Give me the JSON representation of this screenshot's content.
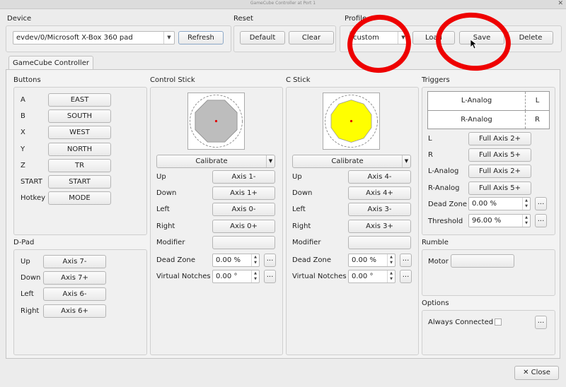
{
  "window": {
    "title": "GameCube Controller at Port 1",
    "close_glyph": "✕"
  },
  "device": {
    "label": "Device",
    "selected": "evdev/0/Microsoft X-Box 360 pad",
    "refresh": "Refresh"
  },
  "reset": {
    "label": "Reset",
    "default": "Default",
    "clear": "Clear"
  },
  "profile": {
    "label": "Profile",
    "value": "custom",
    "load": "Load",
    "save": "Save",
    "delete": "Delete"
  },
  "tab": {
    "label": "GameCube Controller"
  },
  "buttons": {
    "title": "Buttons",
    "rows": [
      {
        "name": "A",
        "value": "EAST"
      },
      {
        "name": "B",
        "value": "SOUTH"
      },
      {
        "name": "X",
        "value": "WEST"
      },
      {
        "name": "Y",
        "value": "NORTH"
      },
      {
        "name": "Z",
        "value": "TR"
      },
      {
        "name": "START",
        "value": "START"
      },
      {
        "name": "Hotkey",
        "value": "MODE"
      }
    ]
  },
  "dpad": {
    "title": "D-Pad",
    "rows": [
      {
        "name": "Up",
        "value": "Axis 7-"
      },
      {
        "name": "Down",
        "value": "Axis 7+"
      },
      {
        "name": "Left",
        "value": "Axis 6-"
      },
      {
        "name": "Right",
        "value": "Axis 6+"
      }
    ]
  },
  "control_stick": {
    "title": "Control Stick",
    "color": "#bdbdbd",
    "calibrate": "Calibrate",
    "rows": [
      {
        "name": "Up",
        "value": "Axis 1-"
      },
      {
        "name": "Down",
        "value": "Axis 1+"
      },
      {
        "name": "Left",
        "value": "Axis 0-"
      },
      {
        "name": "Right",
        "value": "Axis 0+"
      },
      {
        "name": "Modifier",
        "value": ""
      }
    ],
    "dead_zone": {
      "label": "Dead Zone",
      "value": "0.00 %"
    },
    "virtual_notches": {
      "label": "Virtual Notches",
      "value": "0.00 °"
    }
  },
  "c_stick": {
    "title": "C Stick",
    "color": "#ffff00",
    "calibrate": "Calibrate",
    "rows": [
      {
        "name": "Up",
        "value": "Axis 4-"
      },
      {
        "name": "Down",
        "value": "Axis 4+"
      },
      {
        "name": "Left",
        "value": "Axis 3-"
      },
      {
        "name": "Right",
        "value": "Axis 3+"
      },
      {
        "name": "Modifier",
        "value": ""
      }
    ],
    "dead_zone": {
      "label": "Dead Zone",
      "value": "0.00 %"
    },
    "virtual_notches": {
      "label": "Virtual Notches",
      "value": "0.00 °"
    }
  },
  "triggers": {
    "title": "Triggers",
    "indicator": [
      {
        "name": "L-Analog",
        "key": "L"
      },
      {
        "name": "R-Analog",
        "key": "R"
      }
    ],
    "rows": [
      {
        "name": "L",
        "value": "Full Axis 2+"
      },
      {
        "name": "R",
        "value": "Full Axis 5+"
      },
      {
        "name": "L-Analog",
        "value": "Full Axis 2+"
      },
      {
        "name": "R-Analog",
        "value": "Full Axis 5+"
      }
    ],
    "dead_zone": {
      "label": "Dead Zone",
      "value": "0.00 %"
    },
    "threshold": {
      "label": "Threshold",
      "value": "96.00 %"
    }
  },
  "rumble": {
    "title": "Rumble",
    "motor_label": "Motor",
    "motor_value": ""
  },
  "options": {
    "title": "Options",
    "always_connected": "Always Connected",
    "checked": false
  },
  "ellipsis": "...",
  "close_button": "Close",
  "annotation_color": "#ee0000"
}
